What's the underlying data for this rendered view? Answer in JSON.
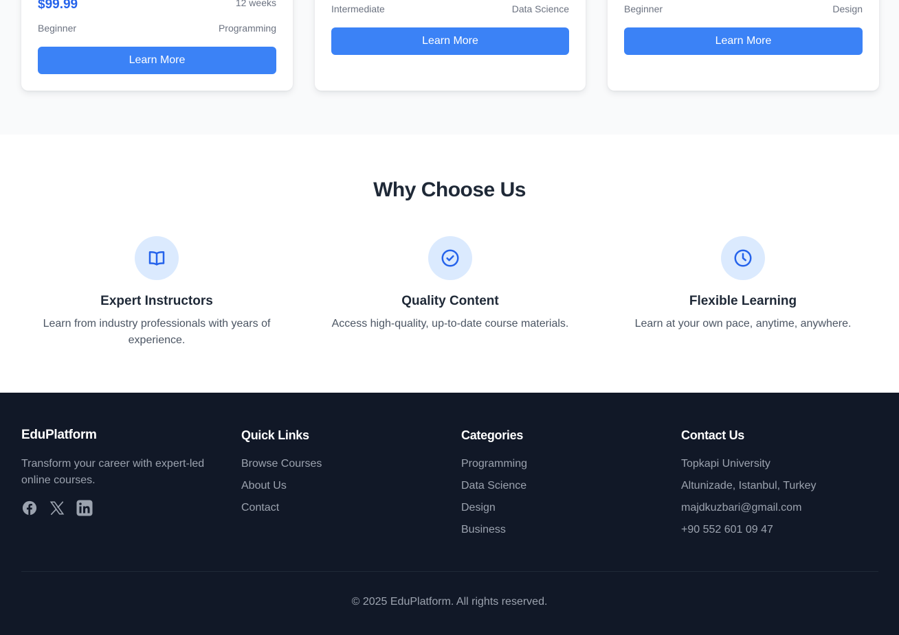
{
  "courses": [
    {
      "price": "$99.99",
      "duration": "12 weeks",
      "level": "Beginner",
      "category": "Programming",
      "button": "Learn More"
    },
    {
      "level": "Intermediate",
      "category": "Data Science",
      "button": "Learn More"
    },
    {
      "level": "Beginner",
      "category": "Design",
      "button": "Learn More"
    }
  ],
  "why": {
    "title": "Why Choose Us",
    "features": [
      {
        "icon": "book-icon",
        "title": "Expert Instructors",
        "description": "Learn from industry professionals with years of experience."
      },
      {
        "icon": "check-circle-icon",
        "title": "Quality Content",
        "description": "Access high-quality, up-to-date course materials."
      },
      {
        "icon": "clock-icon",
        "title": "Flexible Learning",
        "description": "Learn at your own pace, anytime, anywhere."
      }
    ]
  },
  "footer": {
    "brand": {
      "name": "EduPlatform",
      "tagline": "Transform your career with expert-led online courses.",
      "socials": [
        "facebook-icon",
        "x-icon",
        "linkedin-icon"
      ]
    },
    "quick_links": {
      "title": "Quick Links",
      "items": [
        "Browse Courses",
        "About Us",
        "Contact"
      ]
    },
    "categories": {
      "title": "Categories",
      "items": [
        "Programming",
        "Data Science",
        "Design",
        "Business"
      ]
    },
    "contact": {
      "title": "Contact Us",
      "items": [
        "Topkapi University",
        "Altunizade, Istanbul, Turkey",
        "majdkuzbari@gmail.com",
        "+90 552 601 09 47"
      ]
    },
    "copyright": "© 2025 EduPlatform. All rights reserved."
  },
  "colors": {
    "accent": "#3b82f6",
    "price": "#2563eb",
    "icon_bg": "#dbeafe",
    "footer_bg": "#111827",
    "section_bg": "#f9fafb"
  }
}
